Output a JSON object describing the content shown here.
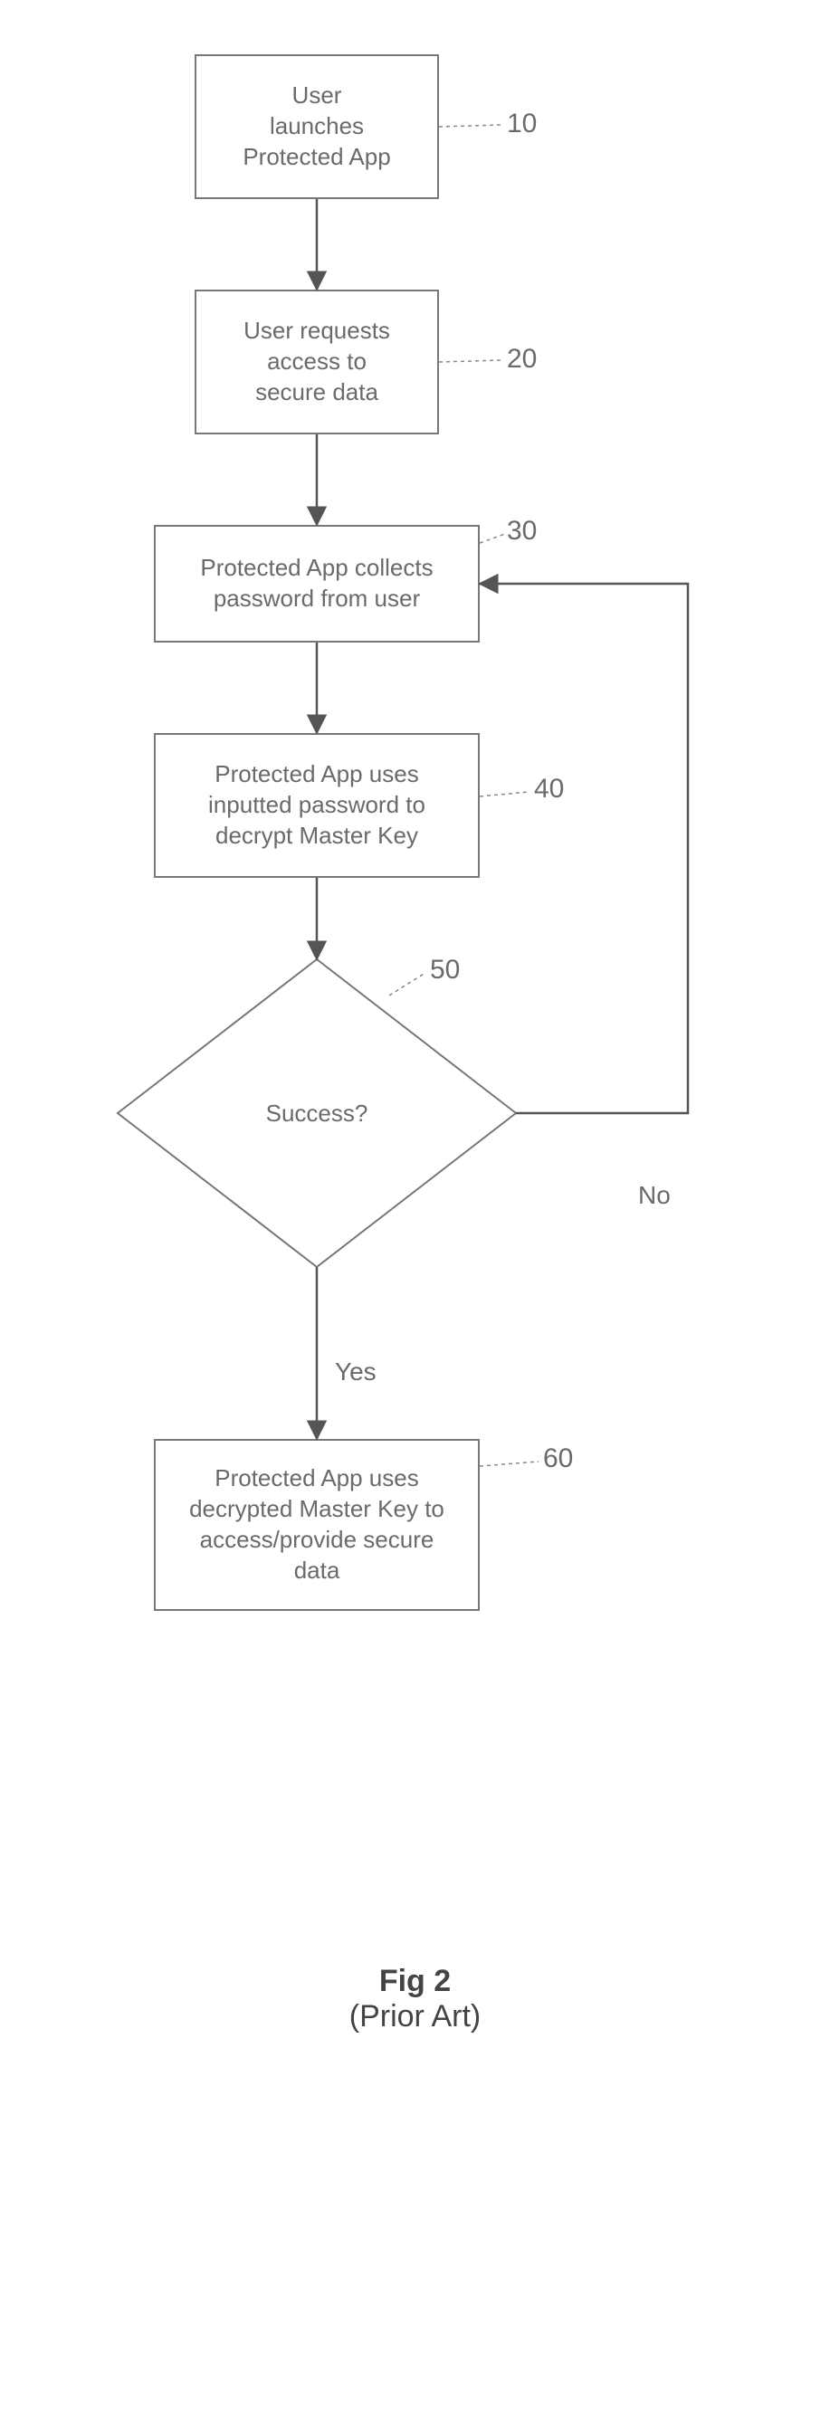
{
  "nodes": {
    "n10": {
      "text": "User\nlaunches\nProtected App",
      "ref": "10"
    },
    "n20": {
      "text": "User requests\naccess to\nsecure data",
      "ref": "20"
    },
    "n30": {
      "text": "Protected App collects\npassword from user",
      "ref": "30"
    },
    "n40": {
      "text": "Protected App uses\ninputted password to\ndecrypt Master Key",
      "ref": "40"
    },
    "n50": {
      "text": "Success?",
      "ref": "50"
    },
    "n60": {
      "text": "Protected App uses\ndecrypted Master Key to\naccess/provide secure\ndata",
      "ref": "60"
    }
  },
  "edges": {
    "yes": "Yes",
    "no": "No"
  },
  "caption": {
    "title": "Fig 2",
    "subtitle": "(Prior Art)"
  },
  "chart_data": {
    "type": "flowchart",
    "nodes": [
      {
        "id": 10,
        "shape": "process",
        "text": "User launches Protected App"
      },
      {
        "id": 20,
        "shape": "process",
        "text": "User requests access to secure data"
      },
      {
        "id": 30,
        "shape": "process",
        "text": "Protected App collects password from user"
      },
      {
        "id": 40,
        "shape": "process",
        "text": "Protected App uses inputted password to decrypt Master Key"
      },
      {
        "id": 50,
        "shape": "decision",
        "text": "Success?"
      },
      {
        "id": 60,
        "shape": "process",
        "text": "Protected App uses decrypted Master Key to access/provide secure data"
      }
    ],
    "edges": [
      {
        "from": 10,
        "to": 20
      },
      {
        "from": 20,
        "to": 30
      },
      {
        "from": 30,
        "to": 40
      },
      {
        "from": 40,
        "to": 50
      },
      {
        "from": 50,
        "to": 60,
        "label": "Yes"
      },
      {
        "from": 50,
        "to": 30,
        "label": "No"
      }
    ],
    "caption": "Fig 2 (Prior Art)"
  }
}
